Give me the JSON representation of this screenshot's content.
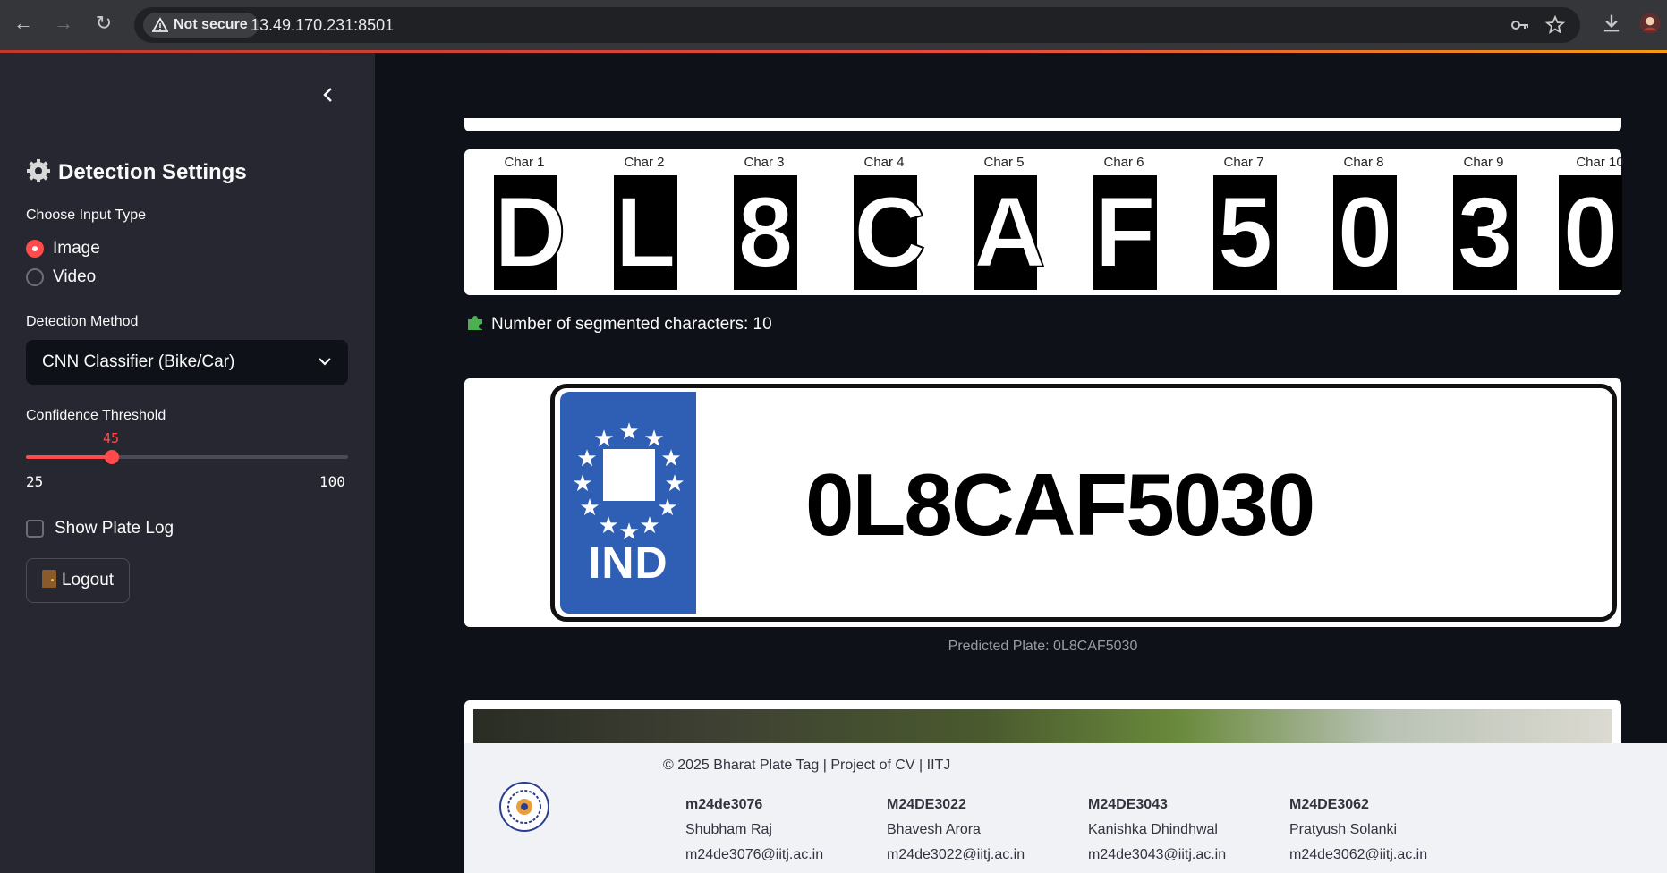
{
  "browser": {
    "security_label": "Not secure",
    "url": "13.49.170.231:8501"
  },
  "sidebar": {
    "title": "Detection Settings",
    "input_type_label": "Choose Input Type",
    "input_options": [
      "Image",
      "Video"
    ],
    "input_selected": "Image",
    "method_label": "Detection Method",
    "method_value": "CNN Classifier (Bike/Car)",
    "confidence_label": "Confidence Threshold",
    "confidence_value": 45,
    "confidence_min": 25,
    "confidence_max": 100,
    "show_log_label": "Show Plate Log",
    "show_log_checked": false,
    "logout_label": "Logout"
  },
  "main": {
    "characters": [
      {
        "label": "Char 1",
        "char": "D"
      },
      {
        "label": "Char 2",
        "char": "L"
      },
      {
        "label": "Char 3",
        "char": "8"
      },
      {
        "label": "Char 4",
        "char": "C"
      },
      {
        "label": "Char 5",
        "char": "A"
      },
      {
        "label": "Char 6",
        "char": "F"
      },
      {
        "label": "Char 7",
        "char": "5"
      },
      {
        "label": "Char 8",
        "char": "0"
      },
      {
        "label": "Char 9",
        "char": "3"
      },
      {
        "label": "Char 10",
        "char": "0"
      }
    ],
    "segmented_count_text": "Number of segmented characters: 10",
    "plate_badge": "IND",
    "plate_text": "0L8CAF5030",
    "predicted_text": "Predicted Plate: 0L8CAF5030"
  },
  "footer": {
    "copyright": "© 2025 Bharat Plate Tag | Project of CV | IITJ",
    "members": [
      {
        "id": "m24de3076",
        "name": "Shubham Raj",
        "email": "m24de3076@iitj.ac.in"
      },
      {
        "id": "M24DE3022",
        "name": "Bhavesh Arora",
        "email": "m24de3022@iitj.ac.in"
      },
      {
        "id": "M24DE3043",
        "name": "Kanishka Dhindhwal",
        "email": "m24de3043@iitj.ac.in"
      },
      {
        "id": "M24DE3062",
        "name": "Pratyush Solanki",
        "email": "m24de3062@iitj.ac.in"
      }
    ]
  },
  "colors": {
    "accent": "#ff4b4b",
    "sidebar_bg": "#262730",
    "main_bg": "#0e1117",
    "plate_band": "#2f5fb5"
  }
}
